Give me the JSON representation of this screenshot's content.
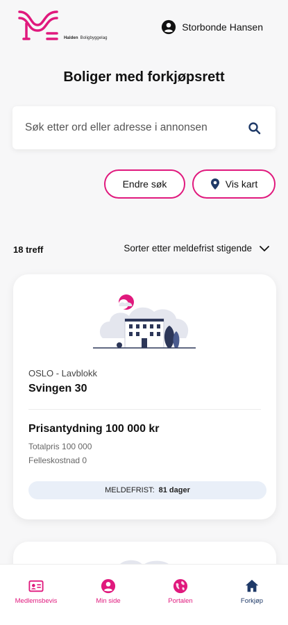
{
  "header": {
    "logo_name": "Halden",
    "logo_subtitle": "Boligbyggelag",
    "user_name": "Storbonde Hansen"
  },
  "page": {
    "title": "Boliger med forkjøpsrett"
  },
  "search": {
    "placeholder": "Søk etter ord eller adresse i annonsen"
  },
  "actions": {
    "edit_search": "Endre søk",
    "show_map": "Vis kart"
  },
  "results": {
    "count": "18 treff",
    "sort_label": "Sorter etter meldefrist stigende"
  },
  "listings": [
    {
      "location": "OSLO - Lavblokk",
      "address": "Svingen 30",
      "price": "Prisantydning 100 000 kr",
      "total": "Totalpris 100 000",
      "shared_cost": "Felleskostnad 0",
      "deadline_label": "MELDEFRIST:",
      "deadline_value": "81 dager"
    }
  ],
  "tabbar": {
    "items": [
      {
        "label": "Medlemsbevis",
        "icon": "id-card-icon"
      },
      {
        "label": "Min side",
        "icon": "user-icon"
      },
      {
        "label": "Portalen",
        "icon": "globe-icon"
      },
      {
        "label": "Forkjøp",
        "icon": "home-icon"
      }
    ]
  },
  "colors": {
    "accent": "#e0197d",
    "navy": "#1f3a68",
    "deadline_bg": "#e9eff8"
  }
}
